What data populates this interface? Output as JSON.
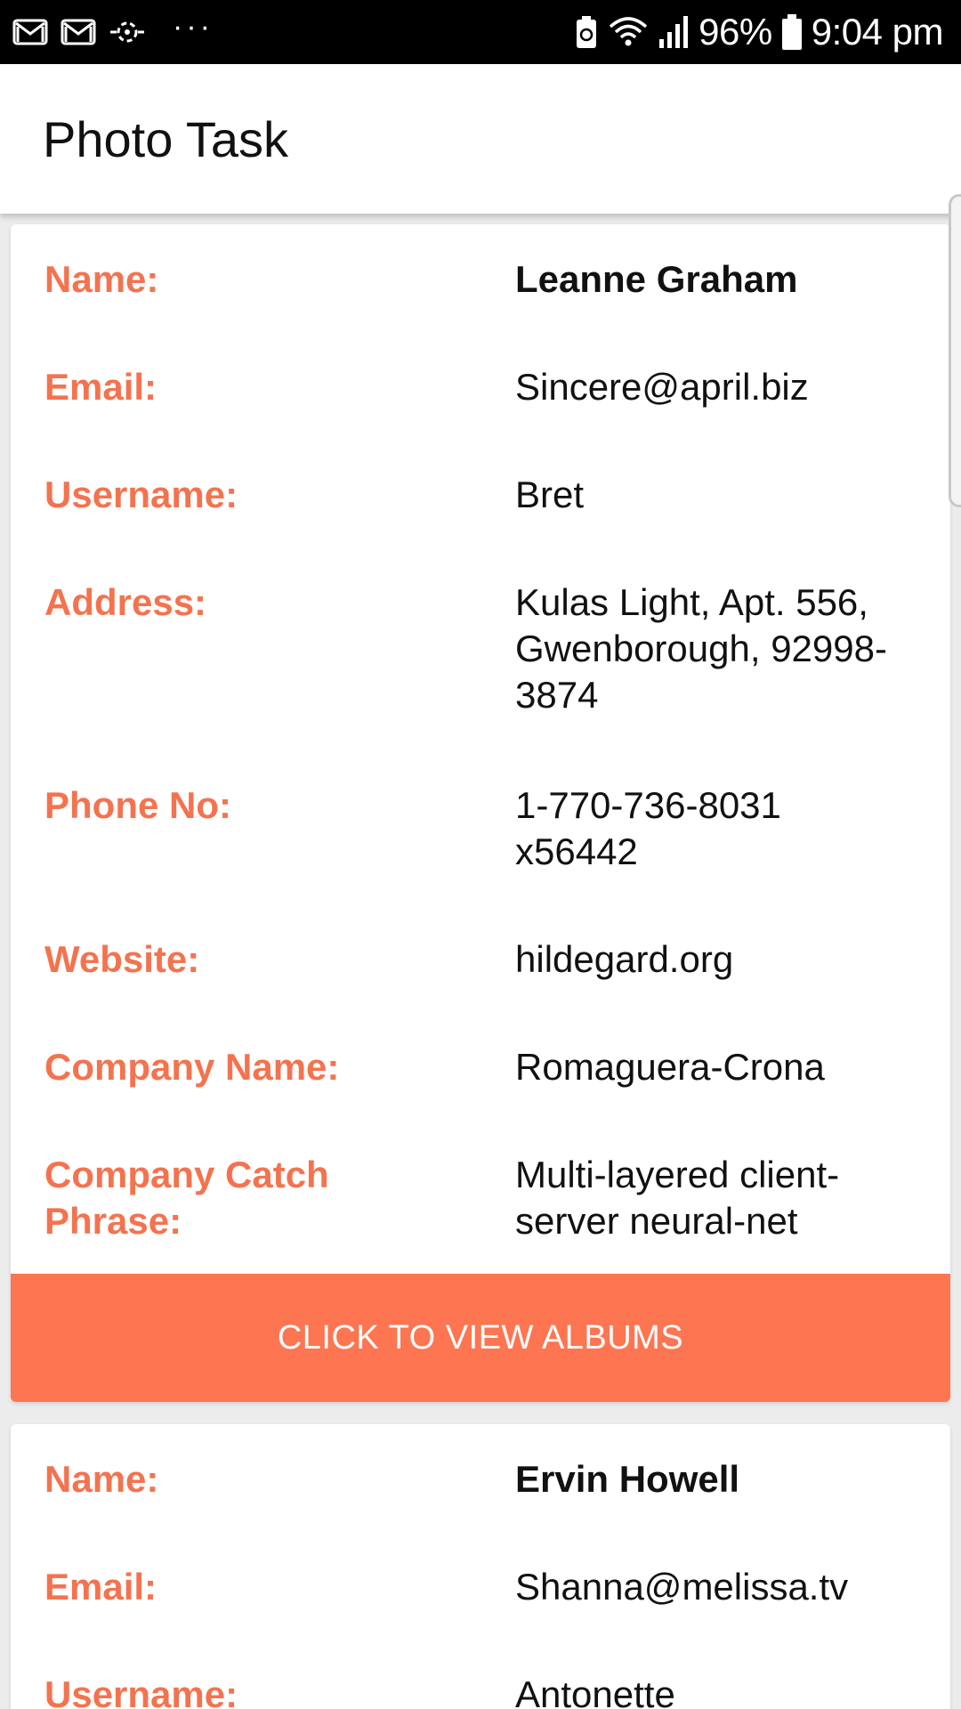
{
  "status_bar": {
    "battery": "96%",
    "time": "9:04 pm",
    "dots": "···",
    "icons": [
      "gmail-icon",
      "gmail-icon",
      "sync-icon",
      "battery-saver-icon",
      "wifi-icon",
      "signal-icon",
      "battery-icon"
    ]
  },
  "appbar": {
    "title": "Photo Task"
  },
  "colors": {
    "accent": "#fd7551",
    "label": "#f4734f"
  },
  "labels": {
    "name": "Name:",
    "email": "Email:",
    "username": "Username:",
    "address": "Address:",
    "phone": "Phone No:",
    "website": "Website:",
    "company_name": "Company Name:",
    "catch_phrase": "Company Catch Phrase:"
  },
  "users": [
    {
      "name": "Leanne Graham",
      "email": "Sincere@april.biz",
      "username": "Bret",
      "address": "Kulas Light, Apt. 556, Gwenborough, 92998-3874",
      "phone": "1-770-736-8031 x56442",
      "website": "hildegard.org",
      "company_name": "Romaguera-Crona",
      "catch_phrase": "Multi-layered client-server neural-net",
      "button_label": "CLICK TO VIEW ALBUMS"
    },
    {
      "name": "Ervin Howell",
      "email": "Shanna@melissa.tv",
      "username": "Antonette"
    }
  ]
}
